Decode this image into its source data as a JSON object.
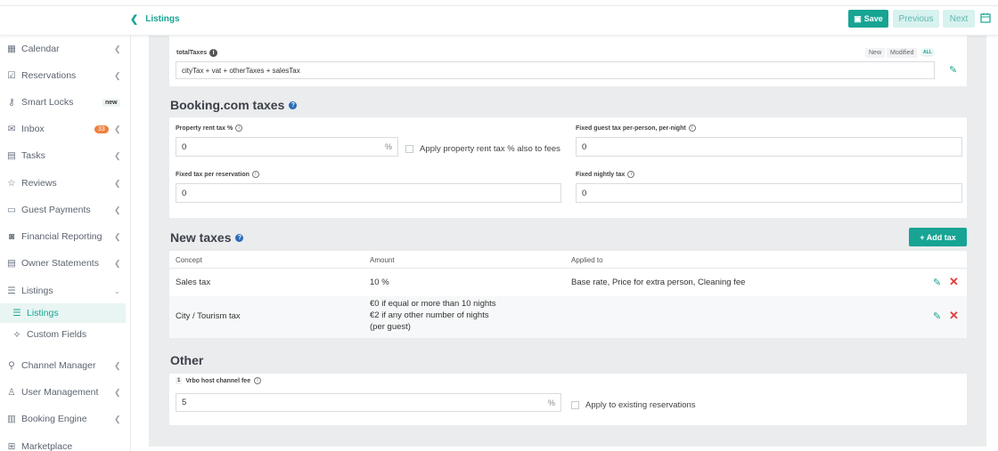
{
  "header": {
    "breadcrumb": "Listings",
    "save_label": "Save",
    "previous_label": "Previous",
    "next_label": "Next"
  },
  "sidebar": {
    "items": [
      {
        "label": "Calendar",
        "icon": "calendar-icon"
      },
      {
        "label": "Reservations",
        "icon": "reservations-icon"
      },
      {
        "label": "Smart Locks",
        "icon": "smart-lock-icon",
        "badge": "new"
      },
      {
        "label": "Inbox",
        "icon": "inbox-icon",
        "count": "33"
      },
      {
        "label": "Tasks",
        "icon": "tasks-icon"
      },
      {
        "label": "Reviews",
        "icon": "star-icon"
      },
      {
        "label": "Guest Payments",
        "icon": "payments-icon"
      },
      {
        "label": "Financial Reporting",
        "icon": "reporting-icon"
      },
      {
        "label": "Owner Statements",
        "icon": "statements-icon"
      },
      {
        "label": "Listings",
        "icon": "list-icon"
      },
      {
        "label": "Listings",
        "icon": "list-icon",
        "active": true
      },
      {
        "label": "Custom Fields",
        "icon": "custom-fields-icon"
      },
      {
        "label": "Channel Manager",
        "icon": "channel-icon"
      },
      {
        "label": "User Management",
        "icon": "user-icon"
      },
      {
        "label": "Booking Engine",
        "icon": "booking-engine-icon"
      },
      {
        "label": "Marketplace",
        "icon": "marketplace-icon"
      }
    ]
  },
  "total_taxes": {
    "label": "totalTaxes",
    "formula": "cityTax + vat + otherTaxes + salesTax",
    "tags": [
      "New",
      "Modified",
      "ALL"
    ]
  },
  "booking_taxes": {
    "title": "Booking.com taxes",
    "property_rent_label": "Property rent tax %",
    "property_rent_value": "0",
    "property_rent_unit": "%",
    "apply_fees_label": "Apply property rent tax % also to fees",
    "fixed_guest_label": "Fixed guest tax per-person, per-night",
    "fixed_guest_value": "0",
    "fixed_res_label": "Fixed tax per reservation",
    "fixed_res_value": "0",
    "fixed_nightly_label": "Fixed nightly tax",
    "fixed_nightly_value": "0"
  },
  "new_taxes": {
    "title": "New taxes",
    "add_label": "+ Add tax",
    "columns": [
      "Concept",
      "Amount",
      "Applied to"
    ],
    "rows": [
      {
        "concept": "Sales tax",
        "amount": [
          "10 %"
        ],
        "applied": "Base rate, Price for extra person, Cleaning fee"
      },
      {
        "concept": "City / Tourism tax",
        "amount": [
          "€0 if equal or more than 10 nights",
          "€2 if any other number of nights",
          "(per guest)"
        ],
        "applied": ""
      }
    ]
  },
  "other": {
    "title": "Other",
    "vrbo_badge": "1",
    "vrbo_label": "Vrbo host channel fee",
    "vrbo_value": "5",
    "vrbo_unit": "%",
    "apply_existing_label": "Apply to existing reservations"
  }
}
